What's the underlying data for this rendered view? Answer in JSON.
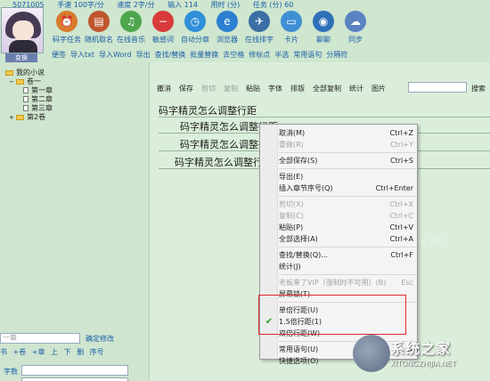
{
  "stats": [
    "5071005",
    "手速 100字/分",
    "速度 2字/分",
    "输入 114",
    "用时 (分)",
    "任务 (分) 60"
  ],
  "avatar": {
    "label": "变换"
  },
  "tools": [
    {
      "label": "码字任务",
      "icon": "alarm-clock-icon",
      "color": "#d97a2b",
      "glyph": "⏰"
    },
    {
      "label": "随机取名",
      "icon": "book-icon",
      "color": "#c0562e",
      "glyph": "▤"
    },
    {
      "label": "在线音乐",
      "icon": "music-note-icon",
      "color": "#4da64d",
      "glyph": "♫"
    },
    {
      "label": "敏感词",
      "icon": "no-entry-icon",
      "color": "#d93b3b",
      "glyph": "−"
    },
    {
      "label": "自动分章",
      "icon": "timer-icon",
      "color": "#2f8fd8",
      "glyph": "◷"
    },
    {
      "label": "浏览器",
      "icon": "ie-browser-icon",
      "color": "#2c7fd1",
      "glyph": "e"
    },
    {
      "label": "在线排字",
      "icon": "rocket-icon",
      "color": "#3a6ea5",
      "glyph": "✈"
    },
    {
      "label": "卡片",
      "icon": "card-icon",
      "color": "#3f8fd4",
      "glyph": "▭"
    },
    {
      "label": "聊聊",
      "icon": "chat-bubble-icon",
      "color": "#2f6fb9",
      "glyph": "◉"
    },
    {
      "label": "同步",
      "icon": "cloud-sync-icon",
      "color": "#5a83c2",
      "glyph": "☁"
    }
  ],
  "menubar": [
    "便签",
    "导入txt",
    "导入Word",
    "导出",
    "查找/替换",
    "批量替换",
    "去空格",
    "修标点",
    "半选",
    "常用语句",
    "分隔符"
  ],
  "tree": {
    "root": "我的小说",
    "vol1": "卷一",
    "ch1": "第一章",
    "ch2": "第二章",
    "ch3": "第三章",
    "vol2": "第2卷"
  },
  "left": {
    "chapter_input": "一章",
    "confirm": "确定修改",
    "ordbar": [
      "书",
      "+卷",
      "+章",
      "上",
      "下",
      "删",
      "序号"
    ],
    "wordcount_label": "字数"
  },
  "toolbar": {
    "items": [
      {
        "label": "撤消",
        "enabled": true
      },
      {
        "label": "保存",
        "enabled": true
      },
      {
        "label": "剪切",
        "enabled": false
      },
      {
        "label": "复制",
        "enabled": false
      },
      {
        "label": "粘贴",
        "enabled": true
      },
      {
        "label": "字体",
        "enabled": true
      },
      {
        "label": "排版",
        "enabled": true
      },
      {
        "label": "全部复制",
        "enabled": true
      },
      {
        "label": "统计",
        "enabled": true
      },
      {
        "label": "图片",
        "enabled": true
      }
    ],
    "search_label": "搜索"
  },
  "editor_lines": [
    "码字精灵怎么调整行距",
    "码字精灵怎么调整行距",
    "码字精灵怎么调整行距",
    "码字精灵怎么调整行距"
  ],
  "watermark": "www.pHome.NET",
  "context_menu": [
    {
      "label": "取消(M)",
      "shortcut": "Ctrl+Z",
      "enabled": true
    },
    {
      "label": "重做(R)",
      "shortcut": "Ctrl+Y",
      "enabled": false
    },
    {
      "sep": true
    },
    {
      "label": "全部保存(S)",
      "shortcut": "Ctrl+S",
      "enabled": true
    },
    {
      "sep": true
    },
    {
      "label": "导出(E)",
      "shortcut": "",
      "enabled": true
    },
    {
      "label": "插入章节序号(Q)",
      "shortcut": "Ctrl+Enter",
      "enabled": true
    },
    {
      "sep": true
    },
    {
      "label": "剪切(X)",
      "shortcut": "Ctrl+X",
      "enabled": false
    },
    {
      "label": "复制(C)",
      "shortcut": "Ctrl+C",
      "enabled": false
    },
    {
      "label": "粘贴(P)",
      "shortcut": "Ctrl+V",
      "enabled": true
    },
    {
      "label": "全部选择(A)",
      "shortcut": "Ctrl+A",
      "enabled": true
    },
    {
      "sep": true
    },
    {
      "label": "查找/替换(Q)...",
      "shortcut": "Ctrl+F",
      "enabled": true
    },
    {
      "label": "统计(J)",
      "shortcut": "",
      "enabled": true
    },
    {
      "sep": true
    },
    {
      "label": "老板来了VIP（强制时不可用）(B)",
      "shortcut": "Esc",
      "enabled": false
    },
    {
      "label": "屏幕锁(T)",
      "shortcut": "",
      "enabled": true
    },
    {
      "sep": true
    },
    {
      "label": "单倍行距(U)",
      "shortcut": "",
      "enabled": true,
      "checked": false
    },
    {
      "label": "1.5倍行距(1)",
      "shortcut": "",
      "enabled": true,
      "checked": true
    },
    {
      "label": "双倍行距(W)",
      "shortcut": "",
      "enabled": true,
      "checked": false
    },
    {
      "sep": true
    },
    {
      "label": "常用语句(U)",
      "shortcut": "",
      "enabled": true,
      "submenu": true
    },
    {
      "label": "快捷选项(O)",
      "shortcut": "",
      "enabled": true
    }
  ],
  "syslogo": {
    "brand": "系统之家",
    "domain": "XITONGZHIJIA.NET"
  },
  "colors": {
    "background": "#d7ead7",
    "link": "#1b5ea8",
    "highlight": "#e02a2a",
    "check": "#2e9e2e"
  }
}
